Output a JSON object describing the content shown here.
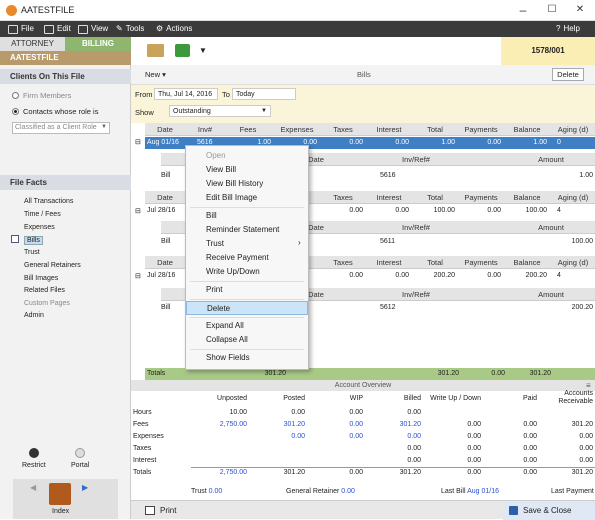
{
  "window": {
    "title": "AATESTFILE",
    "minimize": "–",
    "maximize": "☐",
    "close": "✕"
  },
  "menubar": {
    "items": [
      "File",
      "Edit",
      "View",
      "Tools",
      "Actions"
    ],
    "help": "Help"
  },
  "left": {
    "tabs": {
      "attorney": "ATTORNEY",
      "billing": "BILLING"
    },
    "file_name": "AATESTFILE",
    "clients_header": "Clients On This File",
    "radio_firm": "Firm Members",
    "radio_contacts": "Contacts whose role is",
    "role_select": "Classified as a Client Role",
    "facts_header": "File Facts",
    "facts": [
      "All Transactions",
      "Time / Fees",
      "Expenses",
      "Bills",
      "Trust",
      "General Retainers",
      "Bill Images",
      "Related Files",
      "Custom Pages",
      "Admin"
    ],
    "restrict": "Restrict",
    "portal": "Portal",
    "index": "Index"
  },
  "toolbar": {
    "bill_number": "1578/001",
    "new": "New",
    "bills_label": "Bills",
    "delete": "Delete"
  },
  "filter": {
    "from_label": "From",
    "from_value": "Thu, Jul 14, 2016",
    "to_label": "To",
    "to_value": "Today",
    "show_label": "Show",
    "show_value": "Outstanding"
  },
  "grid": {
    "headers": [
      "Date",
      "Inv#",
      "Fees",
      "Expenses",
      "Taxes",
      "Interest",
      "Total",
      "Payments",
      "Balance",
      "Aging (d)"
    ],
    "sub_headers": [
      "Date",
      "Inv/Ref#",
      "Amount"
    ],
    "rows": [
      {
        "date": "Aug 01/16",
        "inv": "5616",
        "fees": "1.00",
        "expenses": "0.00",
        "taxes": "0.00",
        "interest": "0.00",
        "total": "1.00",
        "payments": "0.00",
        "balance": "1.00",
        "aging": "0",
        "sub_type": "Bill",
        "sub_ref": "5616",
        "sub_amount": "1.00"
      },
      {
        "date": "Jul 28/16",
        "inv": "",
        "fees": "",
        "expenses": "",
        "taxes": "0.00",
        "interest": "0.00",
        "total": "100.00",
        "payments": "0.00",
        "balance": "100.00",
        "aging": "4",
        "sub_type": "Bill",
        "sub_ref": "5611",
        "sub_amount": "100.00"
      },
      {
        "date": "Jul 28/16",
        "inv": "",
        "fees": "",
        "expenses": "",
        "taxes": "0.00",
        "interest": "0.00",
        "total": "200.20",
        "payments": "0.00",
        "balance": "200.20",
        "aging": "4",
        "sub_type": "Bill",
        "sub_ref": "5612",
        "sub_amount": "200.20"
      }
    ],
    "totals": {
      "label": "Totals",
      "fees": "301.20",
      "total": "301.20",
      "payments": "0.00",
      "balance": "301.20"
    }
  },
  "context_menu": [
    "Open",
    "View Bill",
    "View Bill History",
    "Edit Bill Image",
    "Bill",
    "Reminder Statement",
    "Trust",
    "Receive Payment",
    "Write Up/Down",
    "Print",
    "Delete",
    "Expand All",
    "Collapse All",
    "Show Fields"
  ],
  "overview": {
    "title": "Account Overview",
    "cols": [
      "Unposted",
      "Posted",
      "WIP",
      "Billed",
      "Write Up / Down",
      "Paid",
      "Accounts Receivable"
    ],
    "rows": [
      {
        "label": "Hours",
        "vals": [
          "10.00",
          "0.00",
          "0.00",
          "0.00",
          "",
          "",
          ""
        ]
      },
      {
        "label": "Fees",
        "vals": [
          "2,750.00",
          "301.20",
          "0.00",
          "301.20",
          "0.00",
          "0.00",
          "301.20"
        ]
      },
      {
        "label": "Expenses",
        "vals": [
          "",
          "0.00",
          "0.00",
          "0.00",
          "0.00",
          "0.00",
          "0.00"
        ]
      },
      {
        "label": "Taxes",
        "vals": [
          "",
          "",
          "",
          "0.00",
          "0.00",
          "0.00",
          "0.00"
        ]
      },
      {
        "label": "Interest",
        "vals": [
          "",
          "",
          "",
          "0.00",
          "0.00",
          "0.00",
          "0.00"
        ]
      },
      {
        "label": "Totals",
        "vals": [
          "2,750.00",
          "301.20",
          "0.00",
          "301.20",
          "0.00",
          "0.00",
          "301.20"
        ]
      }
    ],
    "trust_label": "Trust",
    "trust_value": "0.00",
    "retainer_label": "General Retainer",
    "retainer_value": "0.00",
    "lastbill_label": "Last Bill",
    "lastbill_value": "Aug 01/16",
    "lastpay_label": "Last Payment"
  },
  "bottom": {
    "print": "Print",
    "save_close": "Save & Close"
  }
}
